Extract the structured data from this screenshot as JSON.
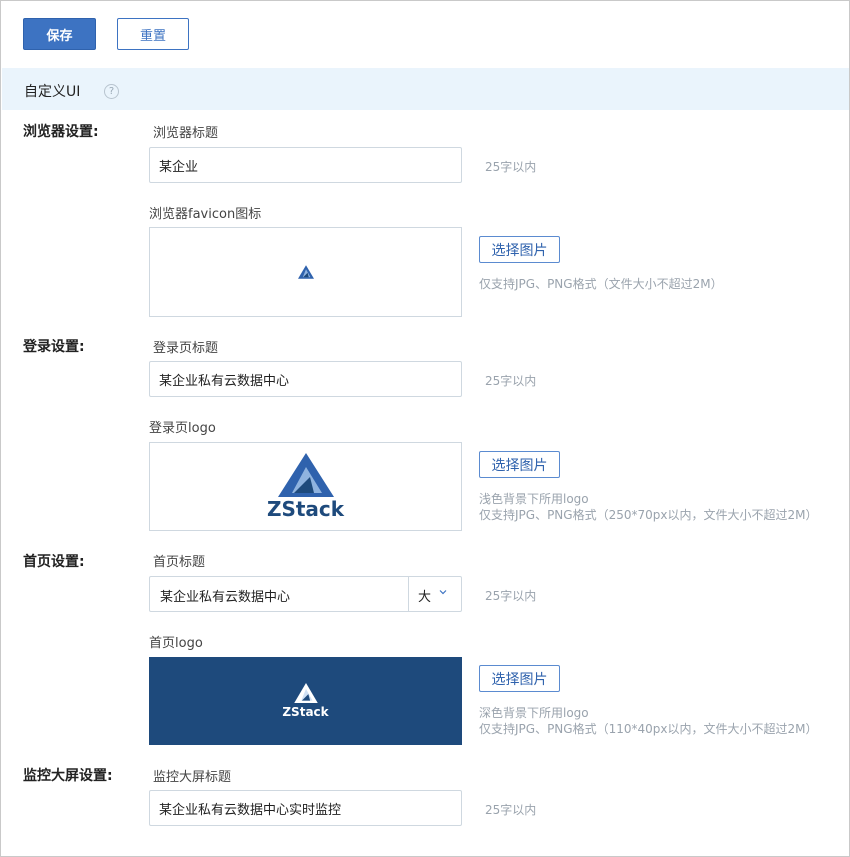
{
  "toolbar": {
    "save_label": "保存",
    "reset_label": "重置"
  },
  "section": {
    "title": "自定义UI",
    "help_glyph": "?"
  },
  "browser": {
    "group_label": "浏览器设置:",
    "title_label": "浏览器标题",
    "title_value": "某企业",
    "title_hint": "25字以内",
    "favicon_label": "浏览器favicon图标",
    "choose_label": "选择图片",
    "favicon_note": "仅支持JPG、PNG格式（文件大小不超过2M）"
  },
  "login": {
    "group_label": "登录设置:",
    "title_label": "登录页标题",
    "title_value": "某企业私有云数据中心",
    "title_hint": "25字以内",
    "logo_label": "登录页logo",
    "logo_text": "ZStack",
    "choose_label": "选择图片",
    "logo_note_1": "浅色背景下所用logo",
    "logo_note_2": "仅支持JPG、PNG格式（250*70px以内，文件大小不超过2M）"
  },
  "home": {
    "group_label": "首页设置:",
    "title_label": "首页标题",
    "title_value": "某企业私有云数据中心",
    "title_size": "大",
    "title_hint": "25字以内",
    "logo_label": "首页logo",
    "logo_text": "ZStack",
    "choose_label": "选择图片",
    "logo_note_1": "深色背景下所用logo",
    "logo_note_2": "仅支持JPG、PNG格式（110*40px以内，文件大小不超过2M）"
  },
  "monitor": {
    "group_label": "监控大屏设置:",
    "title_label": "监控大屏标题",
    "title_value": "某企业私有云数据中心实时监控",
    "title_hint": "25字以内"
  },
  "colors": {
    "accent": "#3d73c2",
    "section_bg": "#eaf4fc",
    "logo_blue": "#1e4a7c",
    "hint_gray": "#9aa3ad"
  },
  "icons": {
    "help": "help-icon",
    "select": "chevron-down-icon",
    "favicon": "zstack-logo-icon"
  }
}
